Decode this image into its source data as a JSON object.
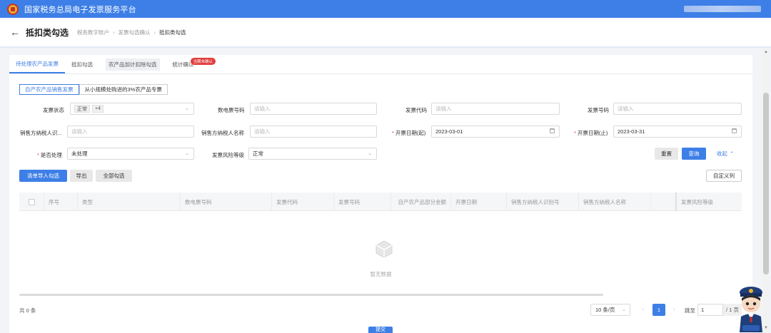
{
  "header": {
    "app_title": "国家税务总局电子发票服务平台"
  },
  "page": {
    "title": "抵扣类勾选",
    "breadcrumb": [
      "税务数字账户",
      "发票勾选确认",
      "抵扣类勾选"
    ]
  },
  "tabs": [
    {
      "label": "待处理农产品发票"
    },
    {
      "label": "抵扣勾选"
    },
    {
      "label": "农产品加计扣除勾选"
    },
    {
      "label": "统计确认",
      "badge": "当期未确认"
    }
  ],
  "subtabs": [
    {
      "label": "自产农产品销售发票"
    },
    {
      "label": "从小规模处购进的3%农产品专票"
    }
  ],
  "filters": {
    "invoice_status": {
      "label": "发票状态",
      "tags": [
        "正常",
        "+4"
      ]
    },
    "e_invoice_no": {
      "label": "数电票号码",
      "placeholder": "请输入"
    },
    "invoice_code": {
      "label": "发票代码",
      "placeholder": "请输入"
    },
    "invoice_no": {
      "label": "发票号码",
      "placeholder": "请输入"
    },
    "seller_tax_id": {
      "label": "销售方纳税人识...",
      "placeholder": "请输入"
    },
    "seller_name": {
      "label": "销售方纳税人名称",
      "placeholder": "请输入"
    },
    "date_from": {
      "label": "开票日期(起)",
      "value": "2023-03-01"
    },
    "date_to": {
      "label": "开票日期(止)",
      "value": "2023-03-31"
    },
    "processed": {
      "label": "是否处理",
      "value": "未处理"
    },
    "risk_level": {
      "label": "发票风险等级",
      "value": "正常"
    }
  },
  "buttons": {
    "reset": "重置",
    "query": "查询",
    "collapse": "收起",
    "import_list": "清单导入勾选",
    "export": "导出",
    "select_all": "全部勾选",
    "custom_columns": "自定义列",
    "submit": "提交"
  },
  "table": {
    "columns": [
      "序号",
      "类型",
      "数电票号码",
      "发票代码",
      "发票号码",
      "自产农产品部分金额",
      "开票日期",
      "销售方纳税人识别号",
      "销售方纳税人名称",
      "",
      "发票风险等级"
    ],
    "empty_text": "暂无数据"
  },
  "pagination": {
    "total": "共 0 条",
    "page_size": "10 条/页",
    "current_page": "1",
    "jump_label": "跳至",
    "jump_value": "1",
    "pages_total": "/ 1 页"
  },
  "colors": {
    "primary": "#3d7fe6",
    "badge": "#e23c3c"
  }
}
